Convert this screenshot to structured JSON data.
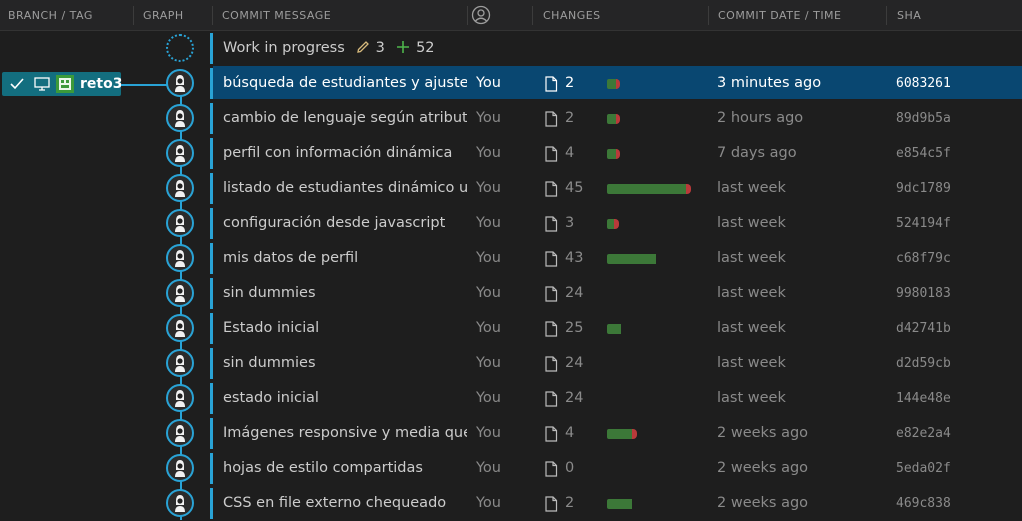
{
  "header": {
    "branch_tag": "BRANCH / TAG",
    "graph": "GRAPH",
    "commit_message": "COMMIT MESSAGE",
    "author_icon": "person-circle-icon",
    "changes": "CHANGES",
    "commit_date": "COMMIT DATE / TIME",
    "sha": "SHA"
  },
  "branch": {
    "name": "reto3",
    "checked_icon": "check-icon",
    "local_icon": "monitor-icon",
    "remote_icon": "avatar-icon"
  },
  "wip": {
    "message": "Work in progress",
    "modified_count": "3",
    "added_count": "52",
    "modified_icon": "pencil-icon",
    "added_icon": "plus-icon"
  },
  "colors": {
    "accent": "#29a3d6",
    "selected": "#094771",
    "added": "#3c7838",
    "deleted": "#b93a3a",
    "branch": "#136e7f"
  },
  "commits": [
    {
      "message": "búsqueda de estudiantes y ajustes finales",
      "author": "You",
      "files": "2",
      "added": 0.1,
      "deleted": 0.04,
      "date": "3 minutes ago",
      "sha": "6083261"
    },
    {
      "message": "cambio de lenguaje según atributo",
      "author": "You",
      "files": "2",
      "added": 0.1,
      "deleted": 0.04,
      "date": "2 hours ago",
      "sha": "89d9b5a"
    },
    {
      "message": "perfil con información dinámica",
      "author": "You",
      "files": "4",
      "added": 0.1,
      "deleted": 0.04,
      "date": "7 days ago",
      "sha": "e854c5f"
    },
    {
      "message": "listado de estudiantes dinámico usando javascript",
      "author": "You",
      "files": "45",
      "added": 0.88,
      "deleted": 0.06,
      "date": "last week",
      "sha": "9dc1789"
    },
    {
      "message": "configuración desde javascript",
      "author": "You",
      "files": "3",
      "added": 0.08,
      "deleted": 0.05,
      "date": "last week",
      "sha": "524194f"
    },
    {
      "message": "mis datos de perfil",
      "author": "You",
      "files": "43",
      "added": 0.54,
      "deleted": 0,
      "date": "last week",
      "sha": "c68f79c"
    },
    {
      "message": "sin dummies",
      "author": "You",
      "files": "24",
      "added": 0,
      "deleted": 0,
      "date": "last week",
      "sha": "9980183"
    },
    {
      "message": "Estado inicial",
      "author": "You",
      "files": "25",
      "added": 0.16,
      "deleted": 0,
      "date": "last week",
      "sha": "d42741b"
    },
    {
      "message": "sin dummies",
      "author": "You",
      "files": "24",
      "added": 0,
      "deleted": 0,
      "date": "last week",
      "sha": "d2d59cb"
    },
    {
      "message": "estado inicial",
      "author": "You",
      "files": "24",
      "added": 0,
      "deleted": 0,
      "date": "last week",
      "sha": "144e48e"
    },
    {
      "message": "Imágenes responsive y media query aplicados",
      "author": "You",
      "files": "4",
      "added": 0.28,
      "deleted": 0.06,
      "date": "2 weeks ago",
      "sha": "e82e2a4"
    },
    {
      "message": "hojas de estilo compartidas",
      "author": "You",
      "files": "0",
      "added": 0,
      "deleted": 0,
      "date": "2 weeks ago",
      "sha": "5eda02f"
    },
    {
      "message": "CSS en file externo chequeado",
      "author": "You",
      "files": "2",
      "added": 0.28,
      "deleted": 0,
      "date": "2 weeks ago",
      "sha": "469c838"
    }
  ]
}
